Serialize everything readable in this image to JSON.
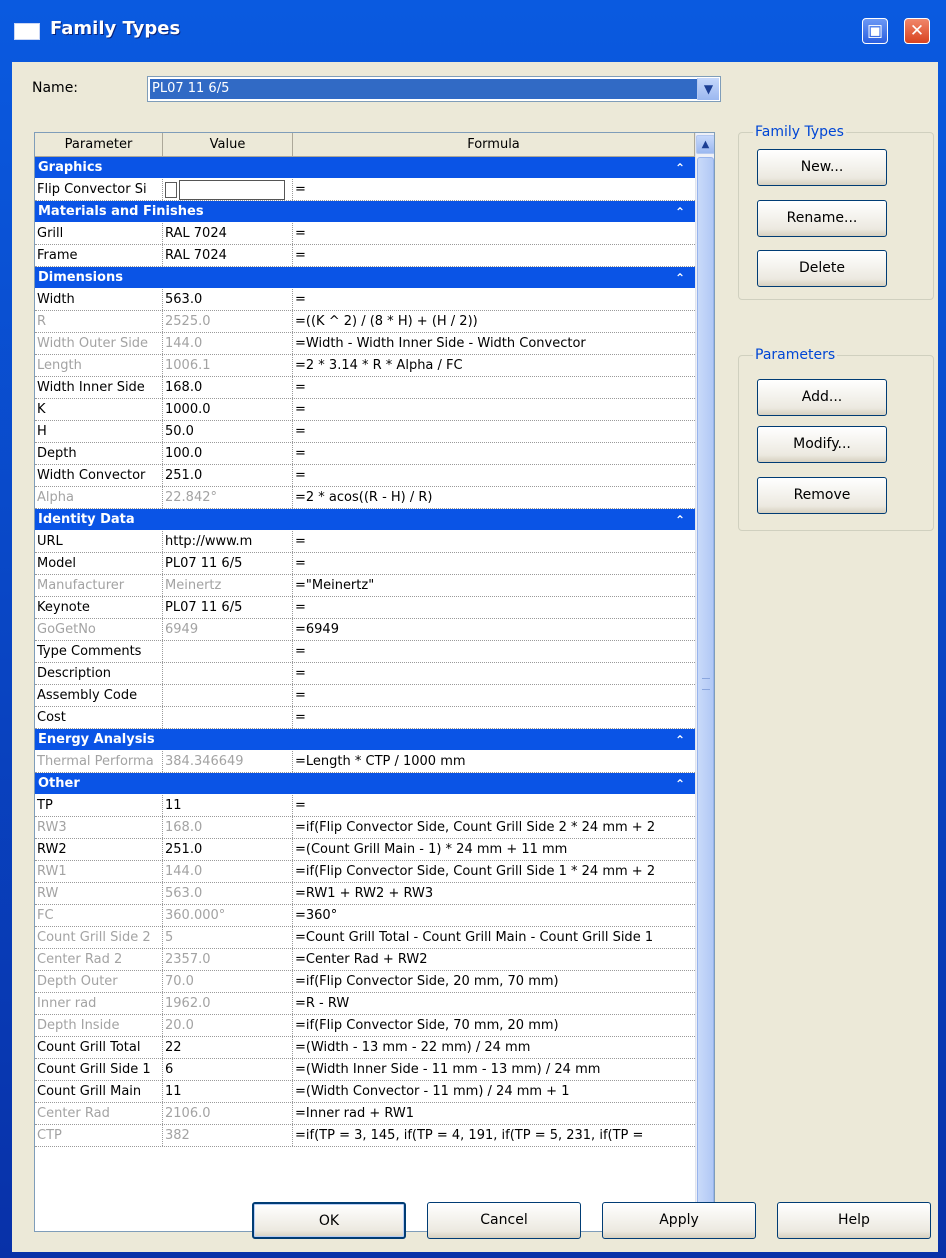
{
  "window": {
    "title": "Family Types"
  },
  "name_field": {
    "label": "Name:",
    "value": "PL07 11 6/5"
  },
  "grid": {
    "headers": [
      "Parameter",
      "Value",
      "Formula"
    ],
    "groups": [
      {
        "title": "Graphics",
        "rows": [
          {
            "param": "Flip Convector Si",
            "value": "",
            "formula": "=",
            "ro": false,
            "checkbox": true
          }
        ]
      },
      {
        "title": "Materials and Finishes",
        "rows": [
          {
            "param": "Grill",
            "value": "RAL 7024",
            "formula": "=",
            "ro": false
          },
          {
            "param": "Frame",
            "value": "RAL 7024",
            "formula": "=",
            "ro": false
          }
        ]
      },
      {
        "title": "Dimensions",
        "rows": [
          {
            "param": "Width",
            "value": "563.0",
            "formula": "=",
            "ro": false
          },
          {
            "param": "R",
            "value": "2525.0",
            "formula": "=((K ^ 2) / (8 * H) + (H / 2))",
            "ro": true
          },
          {
            "param": "Width Outer Side",
            "value": "144.0",
            "formula": "=Width - Width Inner Side - Width Convector",
            "ro": true
          },
          {
            "param": "Length",
            "value": "1006.1",
            "formula": "=2 * 3.14 * R * Alpha / FC",
            "ro": true
          },
          {
            "param": "Width Inner Side",
            "value": "168.0",
            "formula": "=",
            "ro": false
          },
          {
            "param": "K",
            "value": "1000.0",
            "formula": "=",
            "ro": false
          },
          {
            "param": "H",
            "value": "50.0",
            "formula": "=",
            "ro": false
          },
          {
            "param": "Depth",
            "value": "100.0",
            "formula": "=",
            "ro": false
          },
          {
            "param": "Width Convector",
            "value": "251.0",
            "formula": "=",
            "ro": false
          },
          {
            "param": "Alpha",
            "value": "22.842°",
            "formula": "=2 * acos((R - H) / R)",
            "ro": true
          }
        ]
      },
      {
        "title": "Identity Data",
        "rows": [
          {
            "param": "URL",
            "value": "http://www.m",
            "formula": "=",
            "ro": false
          },
          {
            "param": "Model",
            "value": "PL07 11 6/5",
            "formula": "=",
            "ro": false
          },
          {
            "param": "Manufacturer",
            "value": "Meinertz",
            "formula": "=\"Meinertz\"",
            "ro": true
          },
          {
            "param": "Keynote",
            "value": "PL07 11 6/5",
            "formula": "=",
            "ro": false
          },
          {
            "param": "GoGetNo",
            "value": "6949",
            "formula": "=6949",
            "ro": true
          },
          {
            "param": "Type Comments",
            "value": "",
            "formula": "=",
            "ro": false
          },
          {
            "param": "Description",
            "value": "",
            "formula": "=",
            "ro": false
          },
          {
            "param": "Assembly Code",
            "value": "",
            "formula": "=",
            "ro": false
          },
          {
            "param": "Cost",
            "value": "",
            "formula": "=",
            "ro": false
          }
        ]
      },
      {
        "title": "Energy Analysis",
        "rows": [
          {
            "param": "Thermal Performa",
            "value": "384.346649",
            "formula": "=Length * CTP / 1000 mm",
            "ro": true
          }
        ]
      },
      {
        "title": "Other",
        "rows": [
          {
            "param": "TP",
            "value": "11",
            "formula": "=",
            "ro": false
          },
          {
            "param": "RW3",
            "value": "168.0",
            "formula": "=if(Flip Convector Side, Count Grill Side 2 * 24 mm + 2",
            "ro": true
          },
          {
            "param": "RW2",
            "value": "251.0",
            "formula": "=(Count Grill Main - 1) * 24 mm + 11 mm",
            "ro": false
          },
          {
            "param": "RW1",
            "value": "144.0",
            "formula": "=if(Flip Convector Side, Count Grill Side 1 * 24 mm + 2",
            "ro": true
          },
          {
            "param": "RW",
            "value": "563.0",
            "formula": "=RW1 + RW2 + RW3",
            "ro": true
          },
          {
            "param": "FC",
            "value": "360.000°",
            "formula": "=360°",
            "ro": true
          },
          {
            "param": "Count Grill Side 2",
            "value": "5",
            "formula": "=Count Grill Total - Count Grill Main - Count Grill Side 1",
            "ro": true
          },
          {
            "param": "Center Rad 2",
            "value": "2357.0",
            "formula": "=Center Rad + RW2",
            "ro": true
          },
          {
            "param": "Depth Outer",
            "value": "70.0",
            "formula": "=if(Flip Convector Side, 20 mm, 70 mm)",
            "ro": true
          },
          {
            "param": "Inner rad",
            "value": "1962.0",
            "formula": "=R - RW",
            "ro": true
          },
          {
            "param": "Depth Inside",
            "value": "20.0",
            "formula": "=if(Flip Convector Side, 70 mm, 20 mm)",
            "ro": true
          },
          {
            "param": "Count Grill Total",
            "value": "22",
            "formula": "=(Width - 13 mm - 22 mm) / 24 mm",
            "ro": false
          },
          {
            "param": "Count Grill Side 1",
            "value": "6",
            "formula": "=(Width Inner Side - 11 mm - 13 mm) / 24 mm",
            "ro": false
          },
          {
            "param": "Count Grill Main",
            "value": "11",
            "formula": "=(Width Convector - 11 mm) / 24 mm + 1",
            "ro": false
          },
          {
            "param": "Center Rad",
            "value": "2106.0",
            "formula": "=Inner rad + RW1",
            "ro": true
          },
          {
            "param": "CTP",
            "value": "382",
            "formula": "=if(TP = 3, 145, if(TP = 4, 191, if(TP = 5, 231, if(TP =",
            "ro": true
          }
        ]
      }
    ]
  },
  "family_types_panel": {
    "legend": "Family Types",
    "new": "New...",
    "rename": "Rename...",
    "delete": "Delete"
  },
  "parameters_panel": {
    "legend": "Parameters",
    "add": "Add...",
    "modify": "Modify...",
    "remove": "Remove"
  },
  "footer": {
    "ok": "OK",
    "cancel": "Cancel",
    "apply": "Apply",
    "help": "Help"
  }
}
